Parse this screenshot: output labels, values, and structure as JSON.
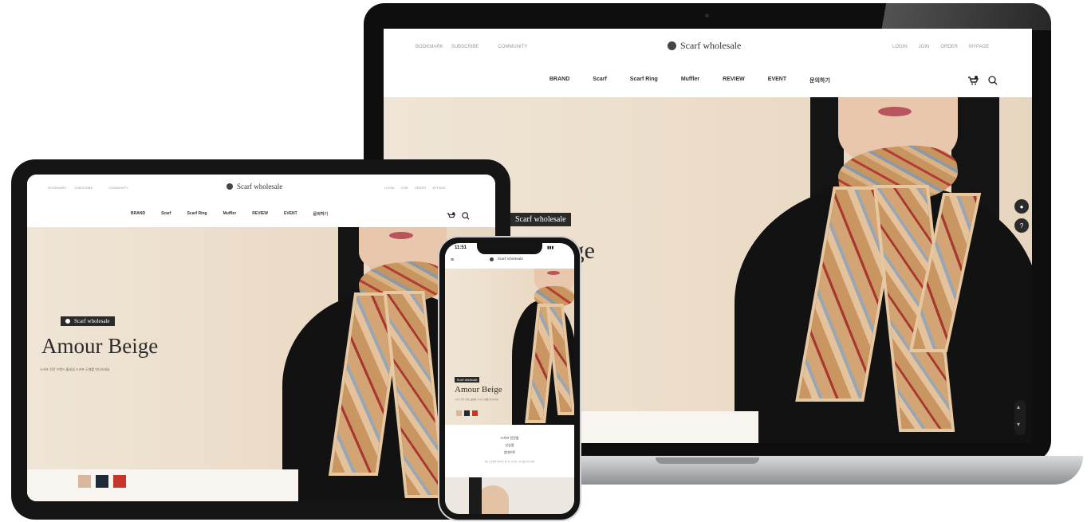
{
  "site": {
    "logo_text": "Scarf wholesale",
    "util_left": [
      "BOOKMARK",
      "SUBSCRIBE",
      "COMMUNITY"
    ],
    "util_right": [
      "LOGIN",
      "JOIN",
      "ORDER",
      "MYPAGE"
    ],
    "nav": [
      "BRAND",
      "Scarf",
      "Scarf Ring",
      "Muffler",
      "REVIEW",
      "EVENT",
      "문의하기"
    ]
  },
  "hero": {
    "badge_text": "Scarf wholesale",
    "title": "Amour Beige",
    "subtitle": "스카프 전문 브랜드 홀세일 스카프 도매를 만나보세요"
  },
  "mobile": {
    "time": "11:51",
    "notice_lines": [
      "스카프 전문몰",
      "신상품",
      "업데이트"
    ],
    "notice_small": "매주 신상품이 업데이트 됩니다. 다양한 스카프를 만나보세요"
  },
  "colors": {
    "hero_bg": "#ecdfcd",
    "swatch_beige": "#d9b79d",
    "swatch_navy": "#1e2a36",
    "swatch_red": "#c5362b",
    "device_frame": "#111111"
  },
  "icons": [
    "cart-icon",
    "search-icon",
    "chevron-up-icon",
    "chevron-down-icon",
    "menu-icon"
  ]
}
